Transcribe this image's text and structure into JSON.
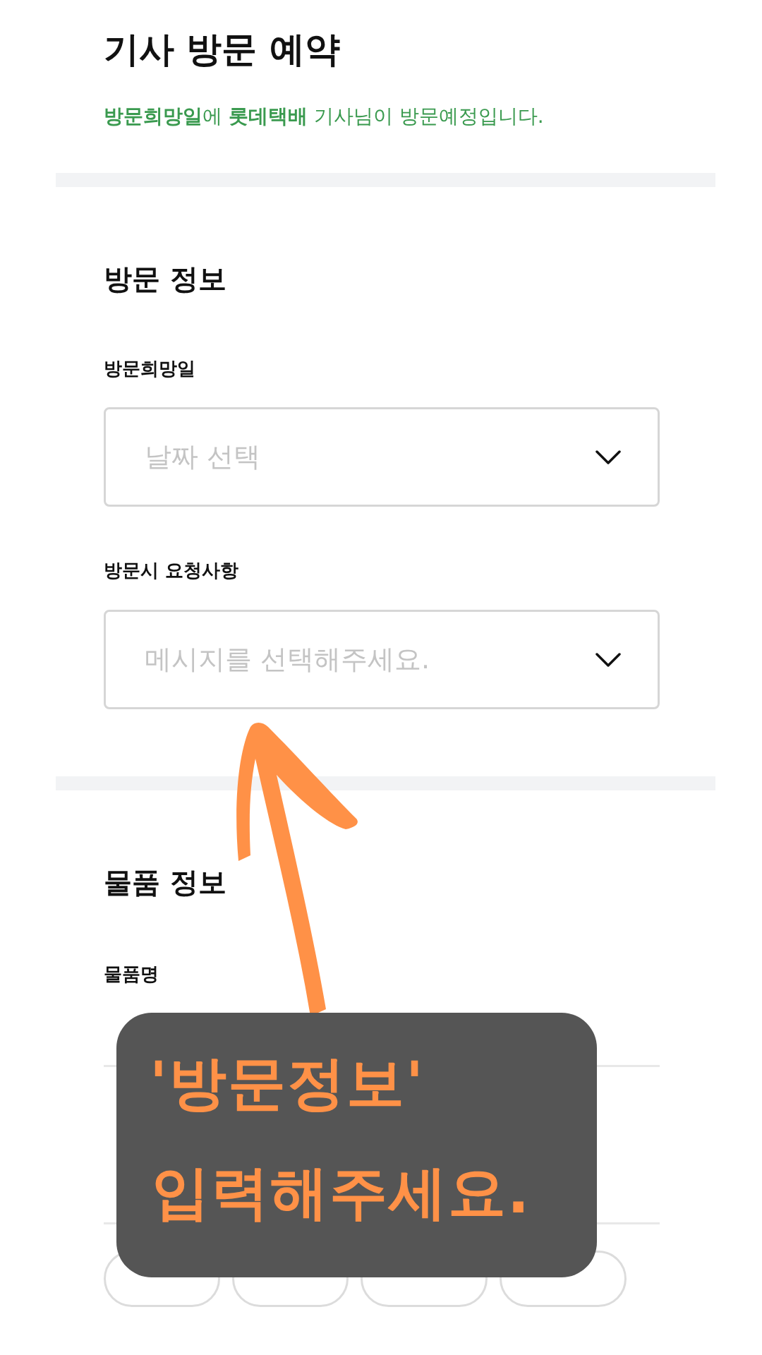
{
  "header": {
    "title": "기사 방문 예약",
    "subtitle": "**방문희망일**에 **롯데택배** 기사님이 방문예정입니다."
  },
  "visit_section": {
    "title": "방문 정보",
    "fields": [
      {
        "label": "방문희망일",
        "placeholder": "날짜 선택"
      },
      {
        "label": "방문시 요청사항",
        "placeholder": "메시지를 선택해주세요."
      }
    ]
  },
  "item_section": {
    "title": "물품 정보",
    "item_name_label": "물품명",
    "amount_chips": [
      {
        "kind": "chip"
      },
      {
        "kind": "chip"
      },
      {
        "kind": "chip"
      },
      {
        "kind": "chip"
      }
    ]
  },
  "annotation": {
    "lines": [
      "'방문정보'",
      "입력해주세요."
    ]
  }
}
